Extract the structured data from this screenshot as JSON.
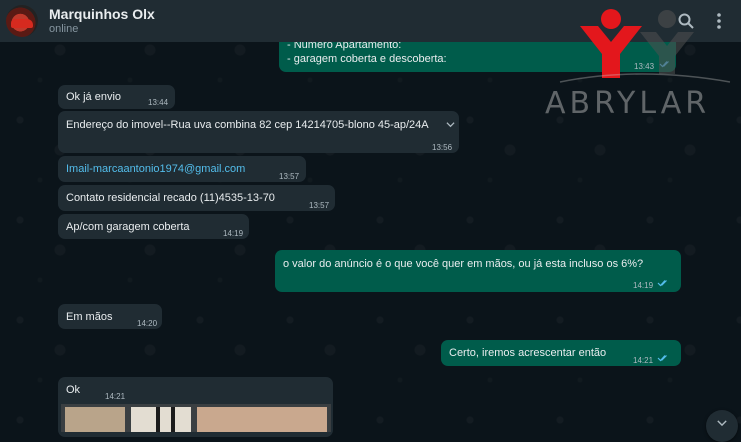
{
  "header": {
    "contact_name": "Marquinhos Olx",
    "status": "online"
  },
  "watermark": {
    "text": "ABRYLAR"
  },
  "messages": [
    {
      "dir": "out",
      "lines": [
        "- Número Apartamento:",
        "- garagem coberta e descoberta:"
      ],
      "time": "13:43"
    },
    {
      "dir": "in",
      "text": "Ok já envio",
      "time": "13:44"
    },
    {
      "dir": "in",
      "text": "Endereço do imovel--Rua uva combina 82 cep 14214705-blono 45-ap/24A",
      "time": "13:56"
    },
    {
      "dir": "in",
      "text": "Imail-marcaantonio1974@gmail.com",
      "time": "13:57"
    },
    {
      "dir": "in",
      "text": "Contato residencial recado (11)4535-13-70",
      "time": "13:57"
    },
    {
      "dir": "in",
      "text": "Ap/com garagem coberta",
      "time": "14:19"
    },
    {
      "dir": "out",
      "text": "o valor do anúncio é o que você quer em mãos, ou já esta incluso os 6%?",
      "time": "14:19"
    },
    {
      "dir": "in",
      "text": "Em mãos",
      "time": "14:20"
    },
    {
      "dir": "out",
      "text": "Certo, iremos acrescentar então",
      "time": "14:21"
    },
    {
      "dir": "in",
      "text": "Ok",
      "time": "14:21"
    }
  ],
  "colors": {
    "chat_bg": "#0b141a",
    "incoming": "#202c33",
    "outgoing": "#005c4b",
    "read_ticks": "#53bdeb",
    "logo_red": "#e3171c"
  },
  "icons": {
    "search": "search-icon",
    "menu": "kebab-menu-icon",
    "scroll": "chevron-down-icon",
    "dropdown": "chevron-down-icon"
  }
}
